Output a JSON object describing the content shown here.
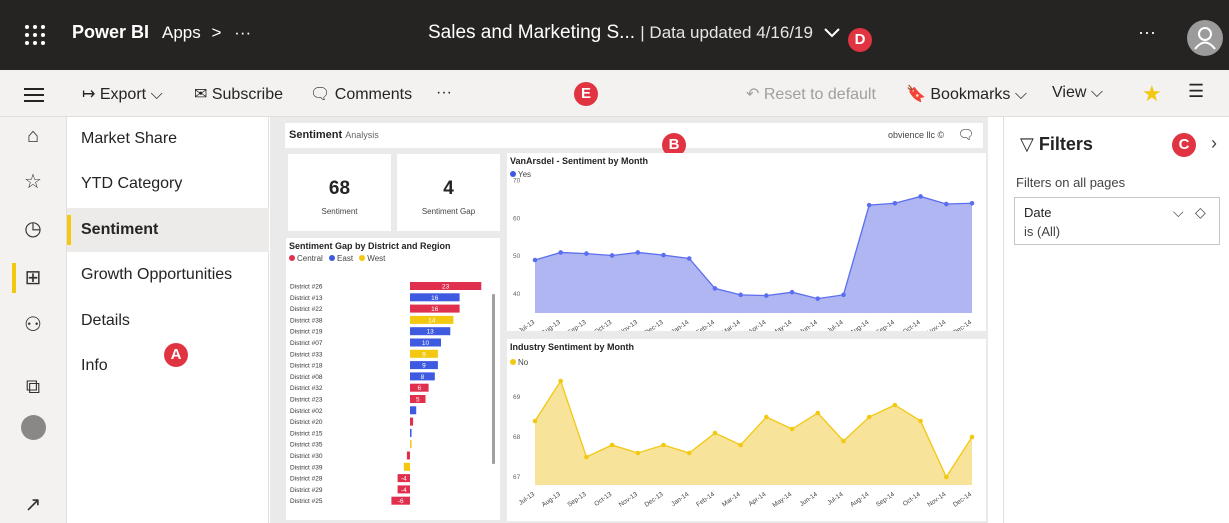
{
  "app": {
    "brand": "Power BI",
    "apps": "Apps",
    "breadcrumb_sep": ">",
    "more": "···"
  },
  "report": {
    "title": "Sales and Marketing S...",
    "updated": "| Data updated 4/16/19",
    "chevron": "⌄"
  },
  "top_more": "···",
  "badges": {
    "a": "A",
    "b": "B",
    "c": "C",
    "d": "D",
    "e": "E"
  },
  "toolbar": {
    "export": "Export",
    "subscribe": "Subscribe",
    "comments": "Comments",
    "more": "···",
    "reset": "Reset to default",
    "bookmarks": "Bookmarks",
    "view": "View"
  },
  "pages": [
    "Market Share",
    "YTD Category",
    "Sentiment",
    "Growth Opportunities",
    "Details",
    "Info"
  ],
  "selected_page": "Sentiment",
  "canvas": {
    "header_title": "Sentiment",
    "header_sub": "Analysis",
    "copyright": "obvience llc ©"
  },
  "kpis": [
    {
      "value": "68",
      "label": "Sentiment"
    },
    {
      "value": "4",
      "label": "Sentiment Gap"
    }
  ],
  "filters": {
    "title": "Filters",
    "section": "Filters on all pages",
    "field": "Date",
    "value": "is (All)"
  },
  "colors": {
    "accent": "#f2c811",
    "badge": "#e03442",
    "central": "#e0304e",
    "east": "#3d5ae0",
    "west": "#f2c811",
    "line_blue": "#5b6ef0",
    "fill_blue": "#a7aef0",
    "fill_yellow": "#f7e08f"
  },
  "chart_data": [
    {
      "type": "bar",
      "title": "Sentiment Gap by District and Region",
      "legend": [
        "Central",
        "East",
        "West"
      ],
      "categories": [
        "District #26",
        "District #13",
        "District #22",
        "District #38",
        "District #19",
        "District #07",
        "District #33",
        "District #18",
        "District #08",
        "District #32",
        "District #23",
        "District #02",
        "District #20",
        "District #15",
        "District #35",
        "District #30",
        "District #39",
        "District #28",
        "District #29",
        "District #25"
      ],
      "values": [
        23,
        16,
        16,
        14,
        13,
        10,
        9,
        9,
        8,
        6,
        5,
        2,
        1,
        0.5,
        0.5,
        -1,
        -2,
        -4,
        -4,
        -6
      ],
      "labels": [
        "23",
        "16",
        "16",
        "14",
        "13",
        "10",
        "9",
        "9",
        "8",
        "6",
        "5",
        "",
        "",
        "",
        "",
        "",
        "",
        "-4",
        "-4",
        "-6"
      ],
      "regions": [
        "Central",
        "East",
        "Central",
        "West",
        "East",
        "East",
        "West",
        "East",
        "East",
        "Central",
        "Central",
        "East",
        "Central",
        "East",
        "West",
        "Central",
        "West",
        "Central",
        "Central",
        "Central"
      ]
    },
    {
      "type": "area",
      "title": "VanArsdel - Sentiment by Month",
      "series": [
        {
          "name": "Yes",
          "values": [
            49,
            51,
            50.7,
            50.2,
            51,
            50.3,
            49.4,
            41.5,
            39.8,
            39.6,
            40.5,
            38.8,
            39.8,
            63.5,
            64,
            65.8,
            63.8,
            64
          ]
        }
      ],
      "x": [
        "Jul-13",
        "Aug-13",
        "Sep-13",
        "Oct-13",
        "Nov-13",
        "Dec-13",
        "Jan-14",
        "Feb-14",
        "Mar-14",
        "Apr-14",
        "May-14",
        "Jun-14",
        "Jul-14",
        "Aug-14",
        "Sep-14",
        "Oct-14",
        "Nov-14",
        "Dec-14"
      ],
      "yticks": [
        "70",
        "60",
        "50",
        "40"
      ],
      "ylim": [
        35,
        72
      ]
    },
    {
      "type": "area",
      "title": "Industry Sentiment by Month",
      "series": [
        {
          "name": "No",
          "values": [
            68.4,
            69.4,
            67.5,
            67.8,
            67.6,
            67.8,
            67.6,
            68.1,
            67.8,
            68.5,
            68.2,
            68.6,
            67.9,
            68.5,
            68.8,
            68.4,
            67.0,
            68.0
          ]
        }
      ],
      "x": [
        "Jul-13",
        "Aug-13",
        "Sep-13",
        "Oct-13",
        "Nov-13",
        "Dec-13",
        "Jan-14",
        "Feb-14",
        "Mar-14",
        "Apr-14",
        "May-14",
        "Jun-14",
        "Jul-14",
        "Aug-14",
        "Sep-14",
        "Oct-14",
        "Nov-14",
        "Dec-14"
      ],
      "yticks": [
        "69",
        "68",
        "67"
      ],
      "ylim": [
        66.8,
        69.7
      ]
    }
  ]
}
